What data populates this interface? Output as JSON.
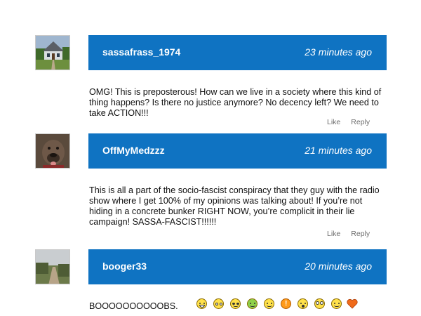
{
  "comments": [
    {
      "username": "sassafrass_1974",
      "time": "23 minutes ago",
      "text": "OMG! This is preposterous! How can we live in a society where this kind of thing happens? Is there no justice anymore? No decency left? We need to take ACTION!!!",
      "like": "Like",
      "reply": "Reply"
    },
    {
      "username": "OffMyMedzzz",
      "time": "21 minutes ago",
      "text": "This is all a part of the socio-fascist conspiracy that they guy with the radio show where I get 100% of my opinions was talking about! If you’re not hiding in a concrete bunker RIGHT NOW, you’re complicit in their lie campaign! SASSA-FASCIST!!!!!!",
      "like": "Like",
      "reply": "Reply"
    },
    {
      "username": "booger33",
      "time": "20 minutes ago",
      "text": "BOOOOOOOOOOBS.",
      "emotes": [
        "laughing-emoji",
        "surprised-emoji",
        "nerd-emoji",
        "green-sick-emoji",
        "smile-emoji",
        "warning-emoji",
        "scared-emoji",
        "goggle-eyed-emoji",
        "grin-emoji",
        "heart-emoji"
      ]
    }
  ],
  "colors": {
    "header_bg": "#0f73c2",
    "header_text": "#ffffff",
    "action_text": "#6d6d6d"
  }
}
